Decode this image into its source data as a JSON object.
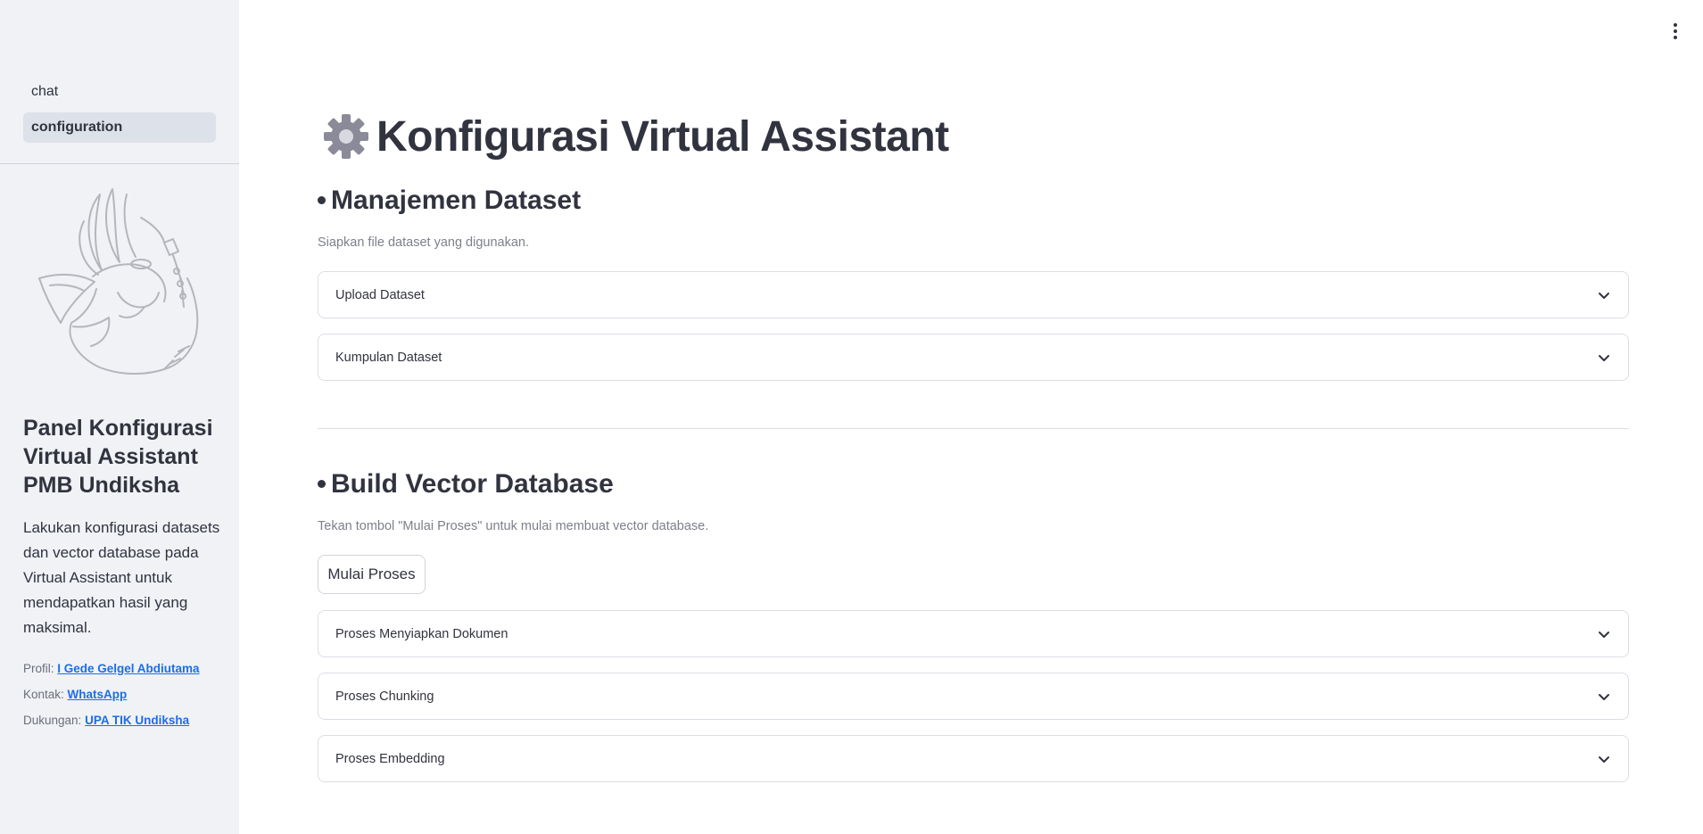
{
  "sidebar": {
    "nav": [
      {
        "label": "chat",
        "active": false
      },
      {
        "label": "configuration",
        "active": true
      }
    ],
    "title": "Panel Konfigurasi Virtual Assistant PMB Undiksha",
    "description": "Lakukan konfigurasi datasets dan vector database pada Virtual Assistant untuk mendapatkan hasil yang maksimal.",
    "links": [
      {
        "prefix": "Profil:",
        "text": "I Gede Gelgel Abdiutama"
      },
      {
        "prefix": "Kontak:",
        "text": "WhatsApp"
      },
      {
        "prefix": "Dukungan:",
        "text": "UPA TIK Undiksha"
      }
    ]
  },
  "main": {
    "title": "Konfigurasi Virtual Assistant",
    "sections": [
      {
        "heading": "Manajemen Dataset",
        "caption": "Siapkan file dataset yang digunakan.",
        "expanders": [
          "Upload Dataset",
          "Kumpulan Dataset"
        ]
      },
      {
        "heading": "Build Vector Database",
        "caption": "Tekan tombol \"Mulai Proses\" untuk mulai membuat vector database.",
        "button": "Mulai Proses",
        "expanders": [
          "Proses Menyiapkan Dokumen",
          "Proses Chunking",
          "Proses Embedding"
        ]
      }
    ]
  },
  "icons": {
    "title_icon": "gear-icon",
    "menu_icon": "kebab-menu-icon",
    "expander_icon": "chevron-down-icon",
    "logo": "ganesha-logo"
  },
  "colors": {
    "sidebar_bg": "#f0f2f6",
    "active_nav_bg": "#dde1ea",
    "link": "#1c6ee8",
    "text": "#31333f",
    "caption": "#7d808a"
  }
}
